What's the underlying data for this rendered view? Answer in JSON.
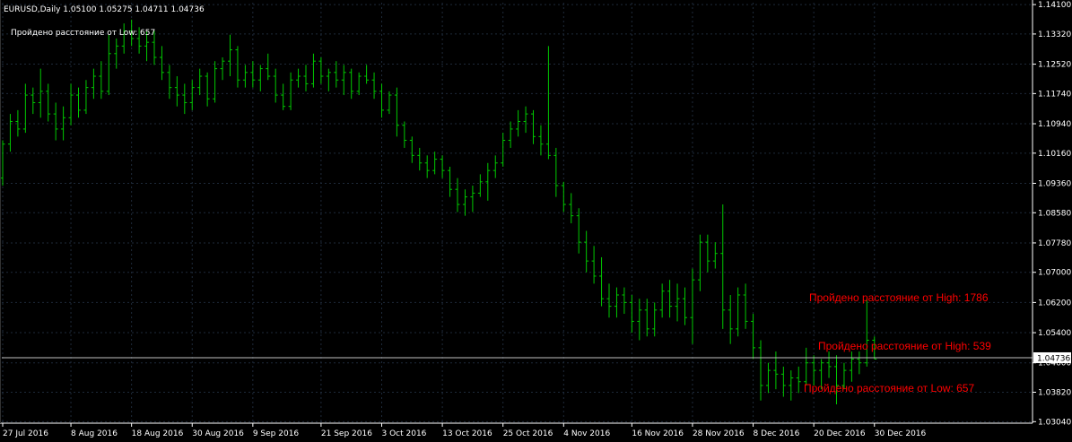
{
  "header": {
    "symbol_line": "EURUSD,Daily  1.05100 1.05275 1.04711 1.04736",
    "indicator_label": "Пройдено расстояние от Low: 657"
  },
  "colors": {
    "background": "#000000",
    "grid": "#1e2a3a",
    "bars": "#00c800",
    "axis": "#ffffff",
    "annotation": "#ff0000",
    "price_line": "#c0c0c0"
  },
  "chart_data": {
    "type": "ohlc",
    "symbol": "EURUSD",
    "timeframe": "Daily",
    "ylim": [
      1.03,
      1.1415
    ],
    "y_ticks": [
      "1.14100",
      "1.13320",
      "1.12520",
      "1.11740",
      "1.10940",
      "1.10160",
      "1.09360",
      "1.08580",
      "1.07780",
      "1.07000",
      "1.06200",
      "1.05400",
      "1.04600",
      "1.03820",
      "1.03040"
    ],
    "current_price": "1.04736",
    "x_ticks": [
      {
        "index": 0,
        "label": "27 Jul 2016"
      },
      {
        "index": 9,
        "label": "8 Aug 2016"
      },
      {
        "index": 17,
        "label": "18 Aug 2016"
      },
      {
        "index": 25,
        "label": "30 Aug 2016"
      },
      {
        "index": 33,
        "label": "9 Sep 2016"
      },
      {
        "index": 42,
        "label": "21 Sep 2016"
      },
      {
        "index": 50,
        "label": "3 Oct 2016"
      },
      {
        "index": 58,
        "label": "13 Oct 2016"
      },
      {
        "index": 66,
        "label": "25 Oct 2016"
      },
      {
        "index": 74,
        "label": "4 Nov 2016"
      },
      {
        "index": 83,
        "label": "16 Nov 2016"
      },
      {
        "index": 91,
        "label": "28 Nov 2016"
      },
      {
        "index": 99,
        "label": "8 Dec 2016"
      },
      {
        "index": 107,
        "label": "20 Dec 2016"
      },
      {
        "index": 115,
        "label": "30 Dec 2016"
      }
    ],
    "bars": [
      [
        1.095,
        1.105,
        1.093,
        1.104
      ],
      [
        1.104,
        1.112,
        1.102,
        1.11
      ],
      [
        1.11,
        1.113,
        1.106,
        1.108
      ],
      [
        1.108,
        1.12,
        1.107,
        1.117
      ],
      [
        1.117,
        1.119,
        1.112,
        1.115
      ],
      [
        1.115,
        1.124,
        1.111,
        1.118
      ],
      [
        1.118,
        1.12,
        1.11,
        1.112
      ],
      [
        1.112,
        1.115,
        1.105,
        1.108
      ],
      [
        1.108,
        1.114,
        1.105,
        1.111
      ],
      [
        1.111,
        1.12,
        1.109,
        1.117
      ],
      [
        1.117,
        1.119,
        1.111,
        1.113
      ],
      [
        1.113,
        1.121,
        1.112,
        1.119
      ],
      [
        1.119,
        1.124,
        1.116,
        1.122
      ],
      [
        1.122,
        1.126,
        1.116,
        1.118
      ],
      [
        1.118,
        1.133,
        1.117,
        1.128
      ],
      [
        1.128,
        1.132,
        1.124,
        1.13
      ],
      [
        1.13,
        1.136,
        1.128,
        1.134
      ],
      [
        1.134,
        1.137,
        1.13,
        1.132
      ],
      [
        1.132,
        1.135,
        1.128,
        1.13
      ],
      [
        1.13,
        1.134,
        1.126,
        1.131
      ],
      [
        1.131,
        1.134,
        1.125,
        1.127
      ],
      [
        1.127,
        1.13,
        1.121,
        1.123
      ],
      [
        1.123,
        1.125,
        1.116,
        1.119
      ],
      [
        1.119,
        1.122,
        1.114,
        1.117
      ],
      [
        1.117,
        1.12,
        1.112,
        1.115
      ],
      [
        1.115,
        1.121,
        1.113,
        1.119
      ],
      [
        1.119,
        1.124,
        1.117,
        1.122
      ],
      [
        1.122,
        1.123,
        1.114,
        1.116
      ],
      [
        1.116,
        1.126,
        1.115,
        1.124
      ],
      [
        1.124,
        1.127,
        1.121,
        1.126
      ],
      [
        1.126,
        1.133,
        1.122,
        1.129
      ],
      [
        1.129,
        1.13,
        1.119,
        1.121
      ],
      [
        1.121,
        1.125,
        1.119,
        1.123
      ],
      [
        1.123,
        1.126,
        1.119,
        1.121
      ],
      [
        1.121,
        1.125,
        1.118,
        1.124
      ],
      [
        1.124,
        1.128,
        1.121,
        1.122
      ],
      [
        1.122,
        1.124,
        1.115,
        1.117
      ],
      [
        1.117,
        1.12,
        1.113,
        1.114
      ],
      [
        1.114,
        1.123,
        1.113,
        1.121
      ],
      [
        1.121,
        1.124,
        1.119,
        1.122
      ],
      [
        1.122,
        1.125,
        1.118,
        1.12
      ],
      [
        1.12,
        1.128,
        1.119,
        1.126
      ],
      [
        1.126,
        1.127,
        1.12,
        1.122
      ],
      [
        1.122,
        1.124,
        1.118,
        1.123
      ],
      [
        1.123,
        1.126,
        1.119,
        1.121
      ],
      [
        1.121,
        1.125,
        1.117,
        1.123
      ],
      [
        1.123,
        1.124,
        1.116,
        1.118
      ],
      [
        1.118,
        1.123,
        1.117,
        1.122
      ],
      [
        1.122,
        1.125,
        1.12,
        1.121
      ],
      [
        1.121,
        1.123,
        1.116,
        1.118
      ],
      [
        1.118,
        1.12,
        1.111,
        1.113
      ],
      [
        1.113,
        1.118,
        1.112,
        1.117
      ],
      [
        1.117,
        1.119,
        1.106,
        1.109
      ],
      [
        1.109,
        1.11,
        1.103,
        1.105
      ],
      [
        1.105,
        1.106,
        1.099,
        1.101
      ],
      [
        1.101,
        1.103,
        1.097,
        1.099
      ],
      [
        1.099,
        1.101,
        1.095,
        1.097
      ],
      [
        1.097,
        1.102,
        1.096,
        1.1
      ],
      [
        1.1,
        1.101,
        1.095,
        1.097
      ],
      [
        1.097,
        1.098,
        1.09,
        1.092
      ],
      [
        1.092,
        1.095,
        1.086,
        1.088
      ],
      [
        1.088,
        1.092,
        1.085,
        1.09
      ],
      [
        1.09,
        1.093,
        1.086,
        1.091
      ],
      [
        1.091,
        1.096,
        1.09,
        1.094
      ],
      [
        1.094,
        1.099,
        1.089,
        1.097
      ],
      [
        1.097,
        1.101,
        1.095,
        1.099
      ],
      [
        1.099,
        1.107,
        1.098,
        1.105
      ],
      [
        1.105,
        1.11,
        1.103,
        1.108
      ],
      [
        1.108,
        1.113,
        1.106,
        1.11
      ],
      [
        1.11,
        1.114,
        1.107,
        1.112
      ],
      [
        1.112,
        1.113,
        1.104,
        1.106
      ],
      [
        1.106,
        1.109,
        1.101,
        1.104
      ],
      [
        1.104,
        1.13,
        1.1,
        1.101
      ],
      [
        1.101,
        1.103,
        1.09,
        1.093
      ],
      [
        1.093,
        1.094,
        1.086,
        1.088
      ],
      [
        1.088,
        1.091,
        1.083,
        1.085
      ],
      [
        1.085,
        1.087,
        1.075,
        1.078
      ],
      [
        1.078,
        1.081,
        1.07,
        1.073
      ],
      [
        1.073,
        1.077,
        1.067,
        1.069
      ],
      [
        1.069,
        1.074,
        1.061,
        1.063
      ],
      [
        1.063,
        1.067,
        1.058,
        1.061
      ],
      [
        1.061,
        1.066,
        1.058,
        1.064
      ],
      [
        1.064,
        1.066,
        1.059,
        1.062
      ],
      [
        1.062,
        1.064,
        1.054,
        1.057
      ],
      [
        1.057,
        1.063,
        1.052,
        1.06
      ],
      [
        1.06,
        1.063,
        1.053,
        1.055
      ],
      [
        1.055,
        1.062,
        1.053,
        1.06
      ],
      [
        1.06,
        1.067,
        1.058,
        1.065
      ],
      [
        1.065,
        1.068,
        1.058,
        1.061
      ],
      [
        1.061,
        1.067,
        1.057,
        1.063
      ],
      [
        1.063,
        1.066,
        1.056,
        1.058
      ],
      [
        1.058,
        1.071,
        1.051,
        1.068
      ],
      [
        1.068,
        1.08,
        1.065,
        1.078
      ],
      [
        1.078,
        1.08,
        1.07,
        1.073
      ],
      [
        1.073,
        1.078,
        1.071,
        1.075
      ],
      [
        1.075,
        1.088,
        1.055,
        1.06
      ],
      [
        1.06,
        1.064,
        1.051,
        1.055
      ],
      [
        1.055,
        1.066,
        1.053,
        1.064
      ],
      [
        1.064,
        1.067,
        1.055,
        1.057
      ],
      [
        1.057,
        1.059,
        1.047,
        1.05
      ],
      [
        1.05,
        1.052,
        1.036,
        1.04
      ],
      [
        1.04,
        1.046,
        1.038,
        1.044
      ],
      [
        1.044,
        1.049,
        1.039,
        1.043
      ],
      [
        1.043,
        1.045,
        1.037,
        1.04
      ],
      [
        1.04,
        1.044,
        1.036,
        1.042
      ],
      [
        1.042,
        1.045,
        1.038,
        1.041
      ],
      [
        1.041,
        1.05,
        1.04,
        1.046
      ],
      [
        1.046,
        1.048,
        1.04,
        1.044
      ],
      [
        1.044,
        1.047,
        1.039,
        1.046
      ],
      [
        1.046,
        1.049,
        1.042,
        1.045
      ],
      [
        1.045,
        1.048,
        1.035,
        1.04
      ],
      [
        1.04,
        1.046,
        1.039,
        1.044
      ],
      [
        1.044,
        1.049,
        1.041,
        1.047
      ],
      [
        1.047,
        1.049,
        1.043,
        1.046
      ],
      [
        1.046,
        1.063,
        1.045,
        1.052
      ],
      [
        1.052,
        1.053,
        1.047,
        1.047
      ]
    ],
    "annotations": [
      {
        "text": "Пройдено расстояние от High: 1786",
        "price": 1.0633
      },
      {
        "text": "Пройдено расстояние от High: 539",
        "price": 1.0505
      },
      {
        "text": "Пройдено расстояние от Low: 657",
        "price": 1.0393
      }
    ]
  }
}
